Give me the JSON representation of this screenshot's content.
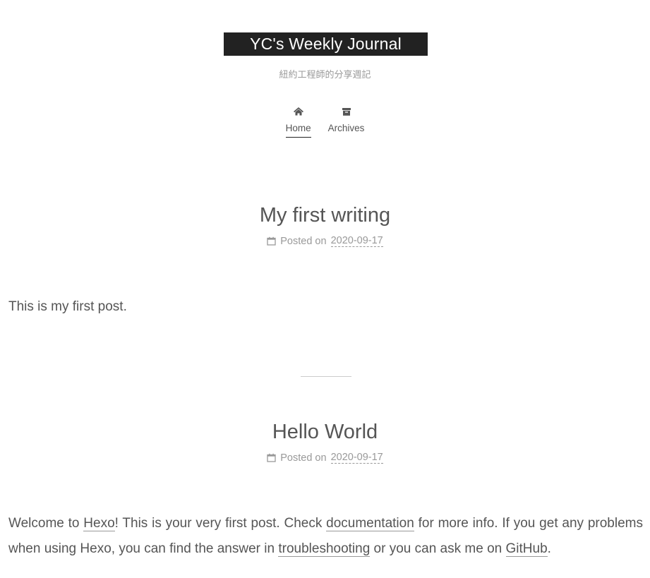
{
  "header": {
    "title": "YC's Weekly Journal",
    "subtitle": "紐約工程師的分享週記"
  },
  "menu": {
    "items": [
      {
        "label": "Home",
        "icon": "home-icon",
        "active": true
      },
      {
        "label": "Archives",
        "icon": "archive-icon",
        "active": false
      }
    ]
  },
  "posts": [
    {
      "title": "My first writing",
      "posted_on_label": "Posted on",
      "date": "2020-09-17",
      "body": "This is my first post."
    },
    {
      "title": "Hello World",
      "posted_on_label": "Posted on",
      "date": "2020-09-17",
      "body": {
        "part1": "Welcome to ",
        "link_hexo": "Hexo",
        "part2": "! This is your very first post. Check ",
        "link_documentation": "documentation",
        "part3": " for more info. If you get any problems when using Hexo, you can find the answer in ",
        "link_troubleshooting": "troubleshooting",
        "part4": " or you can ask me on ",
        "link_github": "GitHub",
        "part5": "."
      }
    }
  ],
  "colors": {
    "brand_bg": "#222222",
    "text": "#555555",
    "muted": "#999999"
  }
}
